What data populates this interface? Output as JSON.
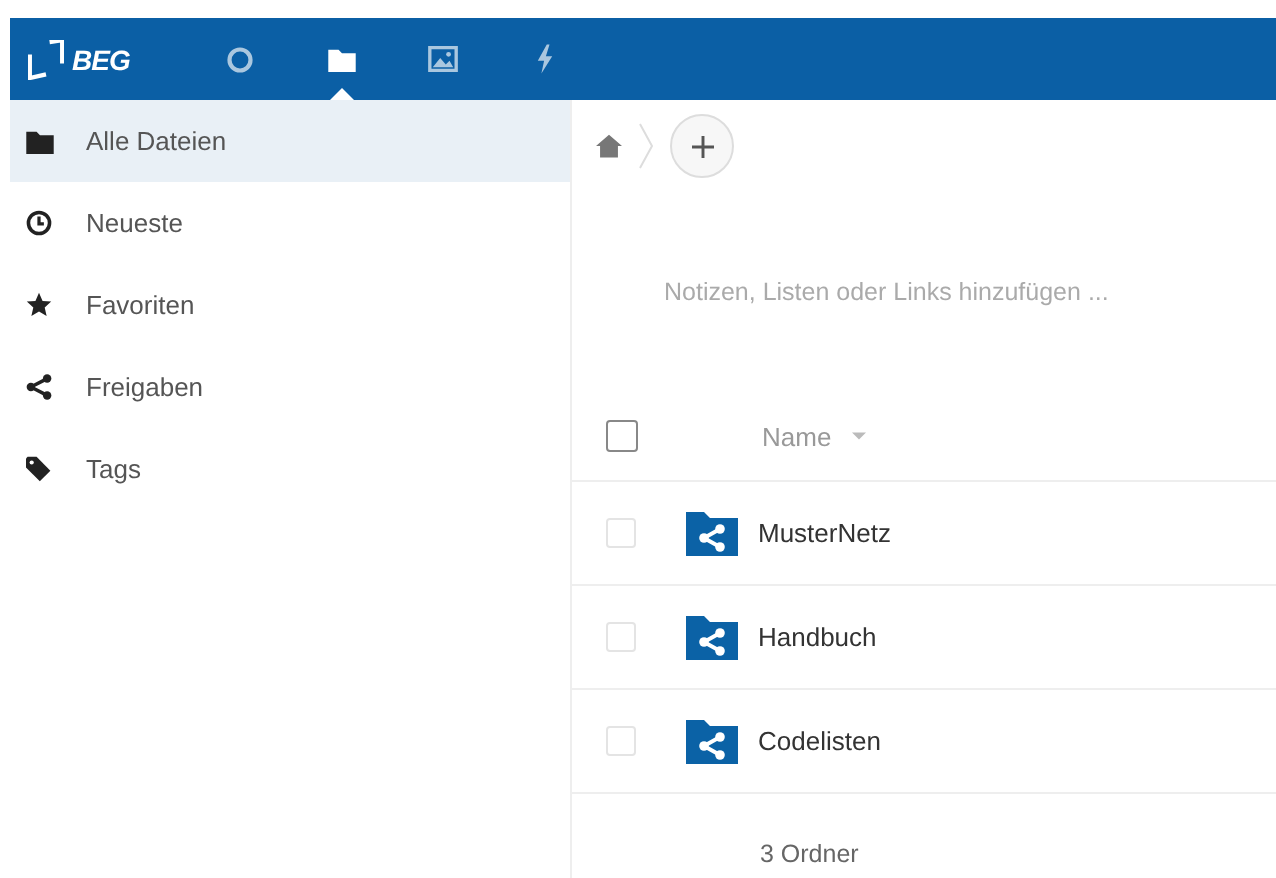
{
  "header": {
    "logo": "BEG",
    "apps": [
      {
        "kind": "circle",
        "selected": false
      },
      {
        "kind": "folder",
        "selected": true
      },
      {
        "kind": "image",
        "selected": false
      },
      {
        "kind": "bolt",
        "selected": false
      }
    ]
  },
  "sidebar": {
    "items": [
      {
        "kind": "folder",
        "label": "Alle Dateien",
        "selected": true
      },
      {
        "kind": "clock",
        "label": "Neueste",
        "selected": false
      },
      {
        "kind": "star",
        "label": "Favoriten",
        "selected": false
      },
      {
        "kind": "share",
        "label": "Freigaben",
        "selected": false
      },
      {
        "kind": "tag",
        "label": "Tags",
        "selected": false
      }
    ]
  },
  "note": {
    "placeholder": "Notizen, Listen oder Links hinzufügen ..."
  },
  "table": {
    "column": "Name",
    "select_all": false,
    "rows": [
      {
        "name": "MusterNetz",
        "checked": false
      },
      {
        "name": "Handbuch",
        "checked": false
      },
      {
        "name": "Codelisten",
        "checked": false
      }
    ],
    "summary": "3 Ordner"
  }
}
